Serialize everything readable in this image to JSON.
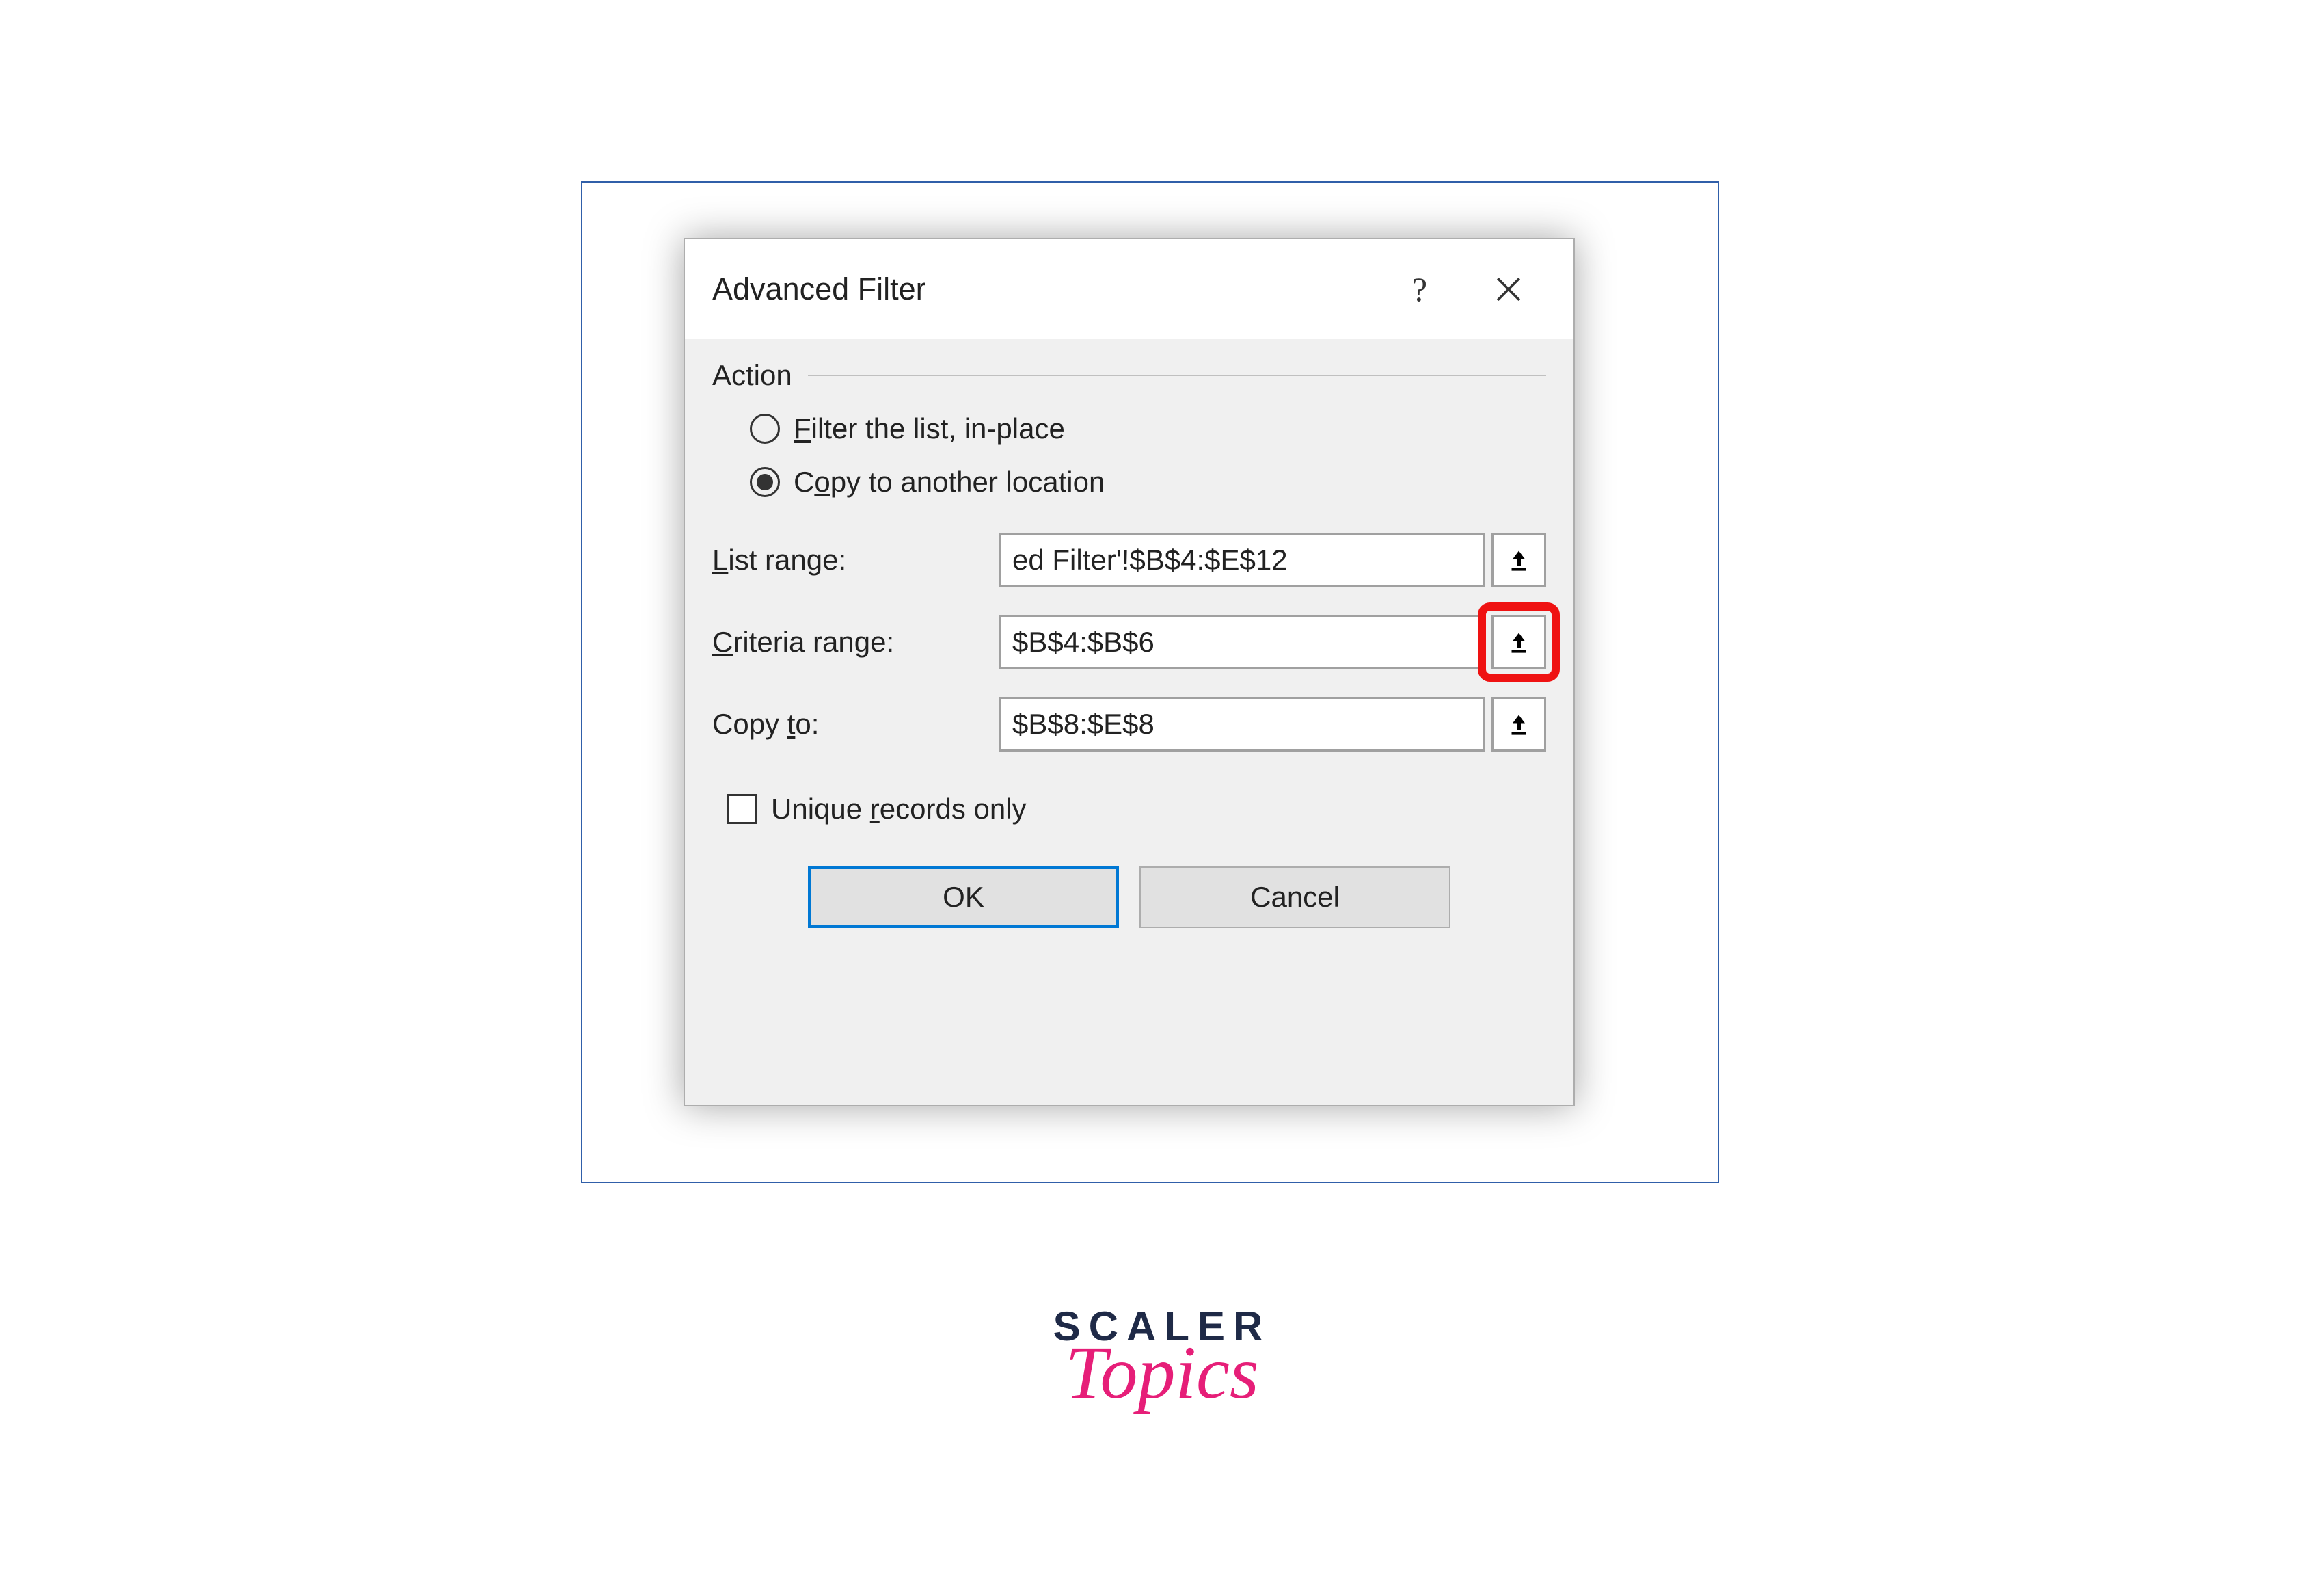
{
  "dialog": {
    "title": "Advanced Filter",
    "group_label": "Action",
    "radio_filter": "Filter the list, in-place",
    "radio_copy": "Copy to another location",
    "list_range_label": "List range:",
    "list_range_value": "ed Filter'!$B$4:$E$12",
    "criteria_range_label": "Criteria range:",
    "criteria_range_value": "$B$4:$B$6",
    "copy_to_label": "Copy to:",
    "copy_to_value": "$B$8:$E$8",
    "unique_label": "Unique records only",
    "ok": "OK",
    "cancel": "Cancel"
  },
  "branding": {
    "line1": "SCALER",
    "line2": "Topics"
  }
}
